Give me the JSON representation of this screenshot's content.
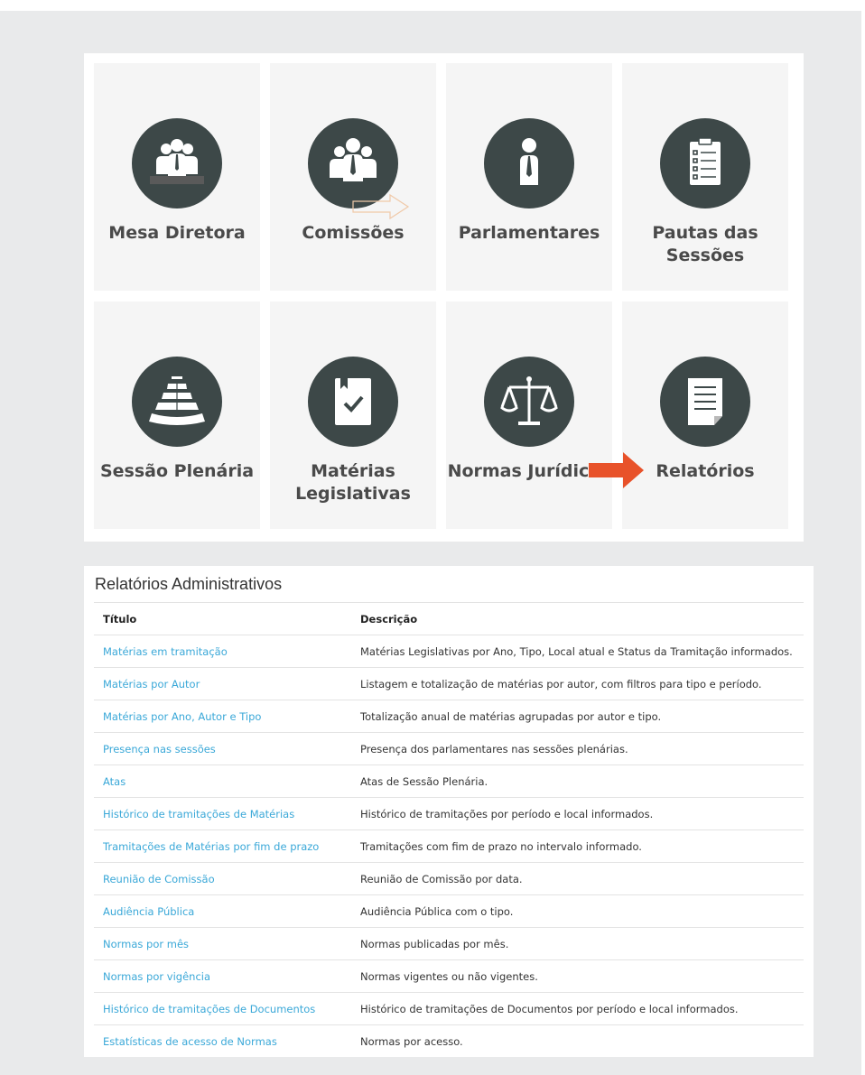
{
  "tiles": [
    {
      "label": "Mesa Diretora",
      "icon": "board-of-directors-icon"
    },
    {
      "label": "Comissões",
      "icon": "committees-icon"
    },
    {
      "label": "Parlamentares",
      "icon": "parliamentarian-icon"
    },
    {
      "label": "Pautas das Sessões",
      "icon": "agenda-clipboard-icon"
    },
    {
      "label": "Sessão Plenária",
      "icon": "plenary-chamber-icon"
    },
    {
      "label": "Matérias Legislativas",
      "icon": "legislative-book-icon"
    },
    {
      "label": "Normas Jurídicas",
      "icon": "scales-of-justice-icon"
    },
    {
      "label": "Relatórios",
      "icon": "report-document-icon"
    }
  ],
  "reports": {
    "heading": "Relatórios Administrativos",
    "columns": [
      "Título",
      "Descrição"
    ],
    "rows": [
      {
        "title": "Matérias em tramitação",
        "description": "Matérias Legislativas por Ano, Tipo, Local atual e Status da Tramitação informados."
      },
      {
        "title": "Matérias por Autor",
        "description": "Listagem e totalização de matérias por autor, com filtros para tipo e período."
      },
      {
        "title": "Matérias por Ano, Autor e Tipo",
        "description": "Totalização anual de matérias agrupadas por autor e tipo."
      },
      {
        "title": "Presença nas sessões",
        "description": "Presença dos parlamentares nas sessões plenárias."
      },
      {
        "title": "Atas",
        "description": "Atas de Sessão Plenária."
      },
      {
        "title": "Histórico de tramitações de Matérias",
        "description": "Histórico de tramitações por período e local informados."
      },
      {
        "title": "Tramitações de Matérias por fim de prazo",
        "description": "Tramitações com fim de prazo no intervalo informado."
      },
      {
        "title": "Reunião de Comissão",
        "description": "Reunião de Comissão por data."
      },
      {
        "title": "Audiência Pública",
        "description": "Audiência Pública com o tipo."
      },
      {
        "title": "Normas por mês",
        "description": "Normas publicadas por mês."
      },
      {
        "title": "Normas por vigência",
        "description": "Normas vigentes ou não vigentes."
      },
      {
        "title": "Histórico de tramitações de Documentos",
        "description": "Histórico de tramitações de Documentos por período e local informados."
      },
      {
        "title": "Estatísticas de acesso de Normas",
        "description": "Normas por acesso."
      }
    ]
  },
  "colors": {
    "page_background": "#e9eaeb",
    "tile_background": "#f5f5f5",
    "icon_circle": "#3d4848",
    "link": "#3aa8d8",
    "arrow_highlight": "#e8522a"
  }
}
